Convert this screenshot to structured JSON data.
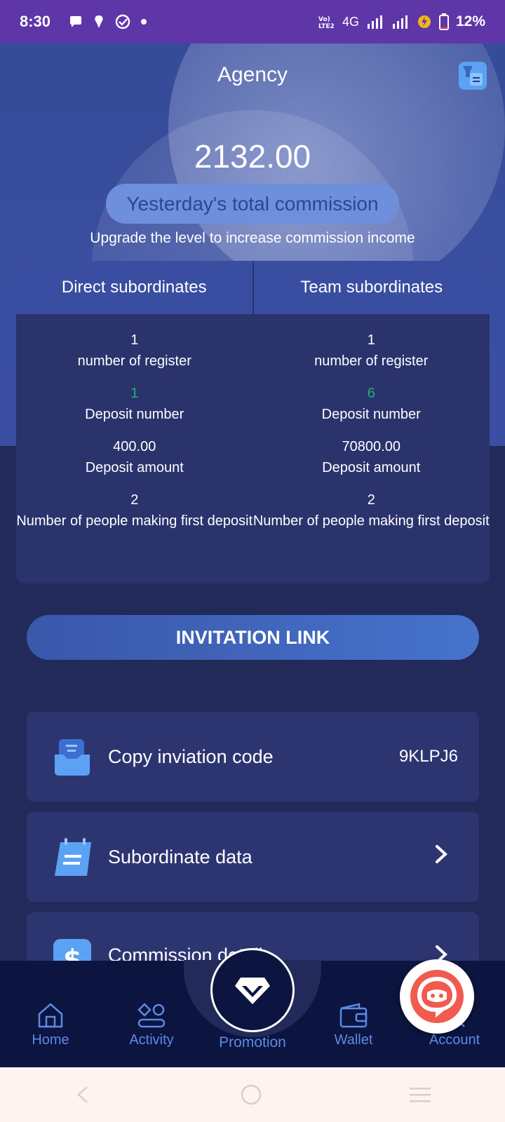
{
  "status_bar": {
    "time": "8:30",
    "network": "4G",
    "battery": "12%"
  },
  "header": {
    "title": "Agency"
  },
  "commission": {
    "amount": "2132.00",
    "label": "Yesterday's total commission",
    "subtitle": "Upgrade the level to increase commission income"
  },
  "subordinates": {
    "tabs": [
      "Direct subordinates",
      "Team subordinates"
    ],
    "direct": [
      {
        "value": "1",
        "label": "number of register"
      },
      {
        "value": "1",
        "label": "Deposit number"
      },
      {
        "value": "400.00",
        "label": "Deposit amount"
      },
      {
        "value": "2",
        "label": "Number of people making first deposit"
      }
    ],
    "team": [
      {
        "value": "1",
        "label": "number of register"
      },
      {
        "value": "6",
        "label": "Deposit number"
      },
      {
        "value": "70800.00",
        "label": "Deposit amount"
      },
      {
        "value": "2",
        "label": "Number of people making first deposit"
      }
    ]
  },
  "invitation_button": "INVITATION LINK",
  "menu": {
    "copy_code": {
      "label": "Copy inviation code",
      "value": "9KLPJ6"
    },
    "subordinate_data": {
      "label": "Subordinate data"
    },
    "commission_details": {
      "label": "Commission details"
    }
  },
  "bottom_nav": {
    "home": "Home",
    "activity": "Activity",
    "promotion": "Promotion",
    "wallet": "Wallet",
    "account": "Account"
  },
  "colors": {
    "accent": "#5b8be3",
    "deposit_green": "#23b06a",
    "status_bar": "#5f36a8"
  }
}
